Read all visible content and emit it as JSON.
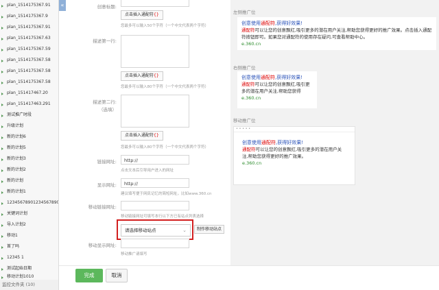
{
  "sidebar": {
    "items": [
      "plan_1514175367.91",
      "plan_1514175367.9",
      "plan_1514175367.91",
      "plan_1514175367.63",
      "plan_1514175367.59",
      "plan_1514175367.58",
      "plan_1514175367.58",
      "plan_1514175367.58",
      "plan_151417467.20",
      "plan_151417463.291",
      "测试推广时段",
      "升级计划",
      "新的计划6",
      "新的计划5",
      "新的计划3",
      "新的计划2",
      "新的计划",
      "新的计划1",
      "12345678901234567890",
      "关键词计划",
      "导入计划2",
      "移动1",
      "首了吗",
      "12345 1",
      "测试起始日期",
      "移动计划1010"
    ],
    "folder_label": "监控文件夹 (10)",
    "collapse_glyph": "«"
  },
  "form": {
    "creative_title_label": "创意标题:",
    "insert_wildcard_label": "点击插入通配符",
    "wildcard_mark": "{}",
    "title_hint": "您最多可以输入50个字符（一个中文代表两个字符）",
    "desc1_label": "描述第一行:",
    "desc1_hint": "您最多可以输入80个字符（一个中文代表两个字符）",
    "desc2_label": "描述第二行:",
    "desc2_sublabel": "（选填）",
    "desc2_hint": "您最多可以输入80个字符（一个中文代表两个字符）",
    "link_url_label": "链接网址:",
    "link_url_value": "http://",
    "link_url_hint": "点击文本后引导用户进入的网址",
    "display_url_label": "显示网址:",
    "display_url_value": "http://",
    "display_url_hint": "建议填写便于网民记忆的简短网址，比如www.360.cn",
    "mobile_link_label": "移动链接网址:",
    "mobile_link_hint": "移动链接网址可填写本行以下方已有站点列表选择",
    "mobile_select_placeholder": "请选择移动站点",
    "make_mobile_site_label": "制作移动站点",
    "mobile_display_label": "移动显示网址:",
    "mobile_display_hint": "移动推广请填写"
  },
  "preview": {
    "left_title": "左侧推广位",
    "right_title": "右侧推广位",
    "mobile_title": "移动推广位",
    "ad_title_prefix": "创意使用",
    "ad_title_highlight": "通配符",
    "ad_title_suffix": ",获得好效果!",
    "left_desc_highlight": "通配符",
    "left_desc": "可以让您的创意飘红,吸引更多的潜在用户关注,帮助您获得更好的推广效果。点击插入通配符按钮即可。如果您对通配符的使用存在疑问,可查看帮助中心。",
    "right_desc_highlight": "通配符",
    "right_desc": "可以让您的创意飘红,吸引更多的潜在用户关注,帮助您获得",
    "mobile_desc_highlight": "通配符",
    "mobile_desc": "可以让您的创意飘红,吸引更多的潜在用户关注,帮助您获得更好的推广效果。",
    "url": "e.360.cn",
    "mobile_bar": "• • • • •"
  },
  "footer": {
    "done_label": "完成",
    "cancel_label": "取消"
  }
}
